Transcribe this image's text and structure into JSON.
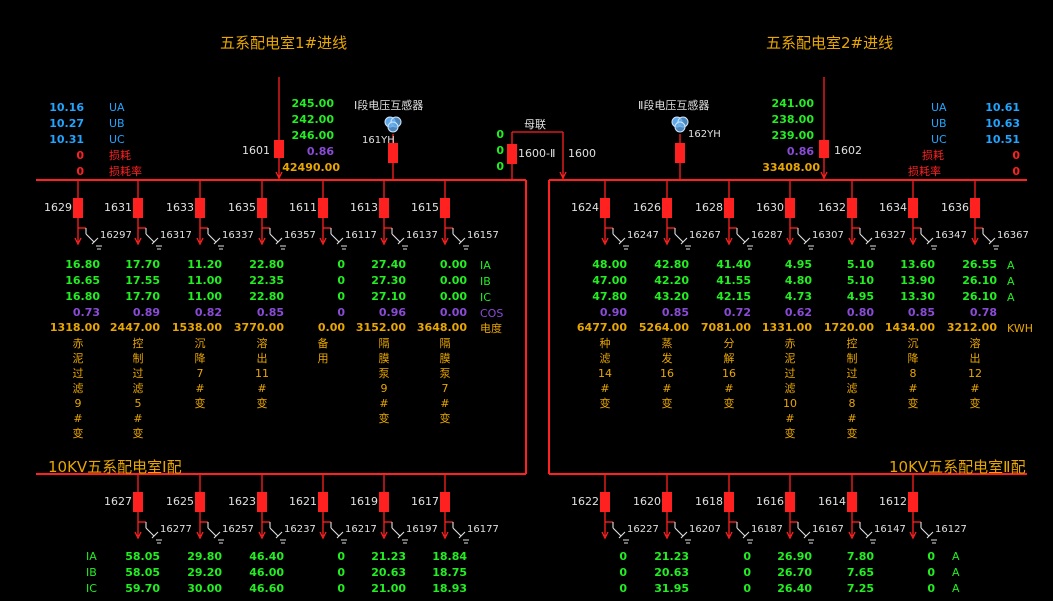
{
  "colors": {
    "green": "#22ee22",
    "blue": "#22a4ff",
    "purple": "#8a4bd6",
    "orange": "#e8a600",
    "red": "#ff2020",
    "white": "#e0e0e0"
  },
  "titles": {
    "in1": "五系配电室1#进线",
    "in2": "五系配电室2#进线",
    "bus1": "10KV五系配电室Ⅰ配",
    "bus2": "10KV五系配电室Ⅱ配"
  },
  "incoming1": {
    "labels": [
      "UA",
      "UB",
      "UC",
      "损耗",
      "损耗率"
    ],
    "values": [
      "10.16",
      "10.27",
      "10.31",
      "0",
      "0"
    ],
    "breaker": "1601",
    "currents": [
      "245.00",
      "242.00",
      "246.00"
    ],
    "cos": "0.86",
    "energy": "42490.00"
  },
  "incoming2": {
    "labels": [
      "UA",
      "UB",
      "UC",
      "损耗",
      "损耗率"
    ],
    "values": [
      "10.61",
      "10.63",
      "10.51",
      "0",
      "0"
    ],
    "breaker": "1602",
    "currents": [
      "241.00",
      "238.00",
      "239.00"
    ],
    "cos": "0.86",
    "energy": "33408.00"
  },
  "pt1": {
    "title": "Ⅰ段电压互感器",
    "code": "161YH"
  },
  "pt2": {
    "title": "Ⅱ段电压互感器",
    "code": "162YH"
  },
  "tie": {
    "title": "母联",
    "left_code": "1600-Ⅱ",
    "right_code": "1600",
    "values": [
      "0",
      "0",
      "0"
    ]
  },
  "row_labels": {
    "left": [
      "IA",
      "IB",
      "IC",
      "COS",
      "电度"
    ],
    "right": [
      "A",
      "A",
      "A",
      "",
      "KWH"
    ],
    "bottom_left": [
      "IA",
      "IB",
      "IC"
    ],
    "bottom_right": [
      "A",
      "A",
      "A"
    ]
  },
  "feeders_top_left": [
    {
      "breaker": "1629",
      "earth": "16297",
      "ia": "16.80",
      "ib": "16.65",
      "ic": "16.80",
      "cos": "0.73",
      "kwh": "1318.00",
      "name": "赤泥过滤9#变"
    },
    {
      "breaker": "1631",
      "earth": "16317",
      "ia": "17.70",
      "ib": "17.55",
      "ic": "17.70",
      "cos": "0.89",
      "kwh": "2447.00",
      "name": "控制过滤5#变"
    },
    {
      "breaker": "1633",
      "earth": "16337",
      "ia": "11.20",
      "ib": "11.00",
      "ic": "11.00",
      "cos": "0.82",
      "kwh": "1538.00",
      "name": "沉降7#变"
    },
    {
      "breaker": "1635",
      "earth": "16357",
      "ia": "22.80",
      "ib": "22.35",
      "ic": "22.80",
      "cos": "0.85",
      "kwh": "3770.00",
      "name": "溶出11#变"
    },
    {
      "breaker": "1611",
      "earth": "16117",
      "ia": "0",
      "ib": "0",
      "ic": "0",
      "cos": "0",
      "kwh": "0.00",
      "name": "备用"
    },
    {
      "breaker": "1613",
      "earth": "16137",
      "ia": "27.40",
      "ib": "27.30",
      "ic": "27.10",
      "cos": "0.96",
      "kwh": "3152.00",
      "name": "隔膜泵9#变"
    },
    {
      "breaker": "1615",
      "earth": "16157",
      "ia": "0.00",
      "ib": "0.00",
      "ic": "0.00",
      "cos": "0.00",
      "kwh": "3648.00",
      "name": "隔膜泵7#变"
    }
  ],
  "feeders_top_right": [
    {
      "breaker": "1624",
      "earth": "16247",
      "ia": "48.00",
      "ib": "47.00",
      "ic": "47.80",
      "cos": "0.90",
      "kwh": "6477.00",
      "name": "种滤14#变"
    },
    {
      "breaker": "1626",
      "earth": "16267",
      "ia": "42.80",
      "ib": "42.20",
      "ic": "43.20",
      "cos": "0.85",
      "kwh": "5264.00",
      "name": "蒸发16#变"
    },
    {
      "breaker": "1628",
      "earth": "16287",
      "ia": "41.40",
      "ib": "41.55",
      "ic": "42.15",
      "cos": "0.72",
      "kwh": "7081.00",
      "name": "分解16#变"
    },
    {
      "breaker": "1630",
      "earth": "16307",
      "ia": "4.95",
      "ib": "4.80",
      "ic": "4.73",
      "cos": "0.62",
      "kwh": "1331.00",
      "name": "赤泥过滤10#变"
    },
    {
      "breaker": "1632",
      "earth": "16327",
      "ia": "5.10",
      "ib": "5.10",
      "ic": "4.95",
      "cos": "0.80",
      "kwh": "1720.00",
      "name": "控制过滤8#变"
    },
    {
      "breaker": "1634",
      "earth": "16347",
      "ia": "13.60",
      "ib": "13.90",
      "ic": "13.30",
      "cos": "0.85",
      "kwh": "1434.00",
      "name": "沉降8#变"
    },
    {
      "breaker": "1636",
      "earth": "16367",
      "ia": "26.55",
      "ib": "26.10",
      "ic": "26.10",
      "cos": "0.78",
      "kwh": "3212.00",
      "name": "溶出12#变"
    }
  ],
  "feeders_bottom_left": [
    {
      "breaker": "1627",
      "earth": "16277",
      "ia": "58.05",
      "ib": "58.05",
      "ic": "59.70"
    },
    {
      "breaker": "1625",
      "earth": "16257",
      "ia": "29.80",
      "ib": "29.20",
      "ic": "30.00"
    },
    {
      "breaker": "1623",
      "earth": "16237",
      "ia": "46.40",
      "ib": "46.00",
      "ic": "46.60"
    },
    {
      "breaker": "1621",
      "earth": "16217",
      "ia": "0",
      "ib": "0",
      "ic": "0"
    },
    {
      "breaker": "1619",
      "earth": "16197",
      "ia": "21.23",
      "ib": "20.63",
      "ic": "21.00"
    },
    {
      "breaker": "1617",
      "earth": "16177",
      "ia": "18.84",
      "ib": "18.75",
      "ic": "18.93"
    }
  ],
  "feeders_bottom_right": [
    {
      "breaker": "1622",
      "earth": "16227",
      "ia": "0",
      "ib": "0",
      "ic": "0"
    },
    {
      "breaker": "1620",
      "earth": "16207",
      "ia": "21.23",
      "ib": "20.63",
      "ic": "31.95"
    },
    {
      "breaker": "1618",
      "earth": "16187",
      "ia": "0",
      "ib": "0",
      "ic": "0"
    },
    {
      "breaker": "1616",
      "earth": "16167",
      "ia": "26.90",
      "ib": "26.70",
      "ic": "26.40"
    },
    {
      "breaker": "1614",
      "earth": "16147",
      "ia": "7.80",
      "ib": "7.65",
      "ic": "7.25"
    },
    {
      "breaker": "1612",
      "earth": "16127",
      "ia": "0",
      "ib": "0",
      "ic": "0"
    }
  ]
}
